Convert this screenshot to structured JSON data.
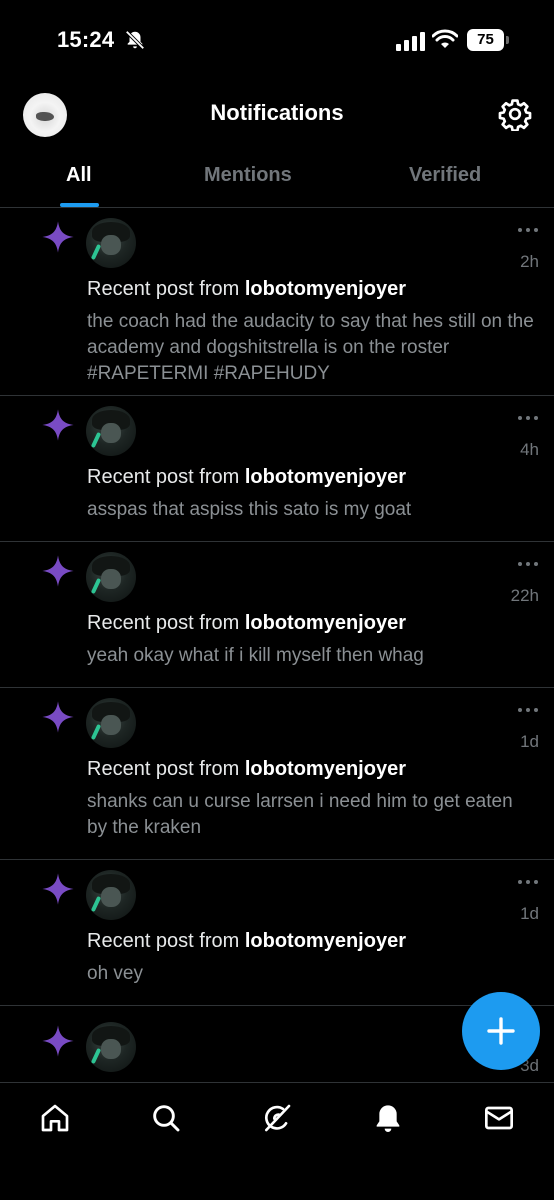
{
  "status_bar": {
    "time": "15:24",
    "battery": "75"
  },
  "header": {
    "title": "Notifications"
  },
  "tabs": [
    {
      "label": "All",
      "active": true
    },
    {
      "label": "Mentions",
      "active": false
    },
    {
      "label": "Verified",
      "active": false
    }
  ],
  "notifications": [
    {
      "prefix": "Recent post from ",
      "user": "lobotomyenjoyer",
      "time": "2h",
      "text": "the coach had the audacity to say that hes still on the academy and dogshitstrella is on the roster #RAPETERMI #RAPEHUDY"
    },
    {
      "prefix": "Recent post from ",
      "user": "lobotomyenjoyer",
      "time": "4h",
      "text": "asspas that aspiss this sato is my goat"
    },
    {
      "prefix": "Recent post from ",
      "user": "lobotomyenjoyer",
      "time": "22h",
      "text": "yeah okay what if i kill myself then whag"
    },
    {
      "prefix": "Recent post from ",
      "user": "lobotomyenjoyer",
      "time": "1d",
      "text": "shanks can u curse larrsen i need him to get eaten by the kraken"
    },
    {
      "prefix": "Recent post from ",
      "user": "lobotomyenjoyer",
      "time": "1d",
      "text": "oh vey"
    },
    {
      "time": "3d"
    }
  ],
  "icons": {
    "sparkle": "sparkle-icon",
    "more": "more-dots-icon",
    "compose": "plus-icon",
    "nav": [
      "home-icon",
      "search-icon",
      "grok-icon",
      "bell-icon",
      "mail-icon"
    ]
  },
  "colors": {
    "accent": "#1d9bf0",
    "sparkle": "#794bc4",
    "background": "#000000",
    "secondary_text": "#71767b"
  }
}
